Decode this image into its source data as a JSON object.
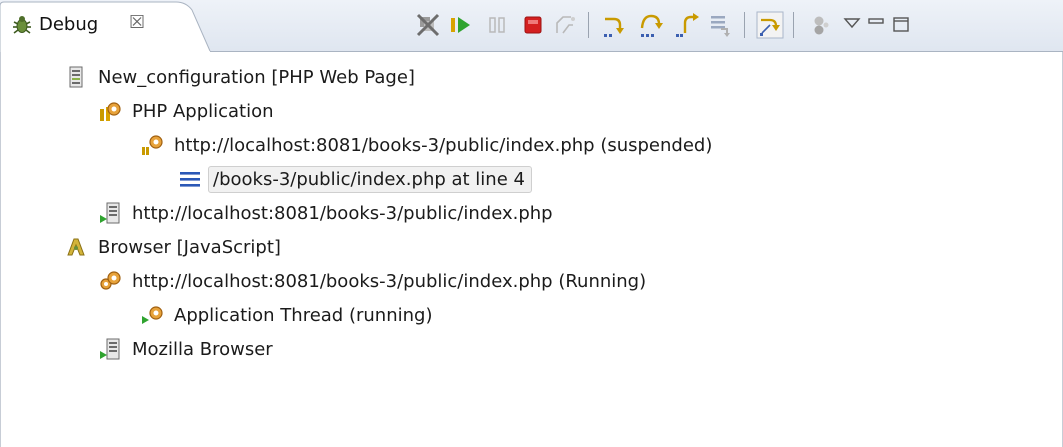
{
  "tab": {
    "label": "Debug",
    "close_glyph": "☒",
    "icon": "debug-bug-icon"
  },
  "toolbar": {
    "icons": [
      "remove-all-terminated-icon",
      "resume-icon",
      "suspend-icon",
      "terminate-icon",
      "disconnect-icon",
      "step-into-icon",
      "step-over-icon",
      "step-return-icon",
      "drop-to-frame-icon",
      "use-step-filters-icon",
      "collapse-icon",
      "view-menu-icon",
      "minimize-icon",
      "maximize-icon"
    ]
  },
  "colors": {
    "resume": "#2fa32f",
    "terminate": "#d42020",
    "step": "#c99a00",
    "selected_bg": "#f1f1f1",
    "tab_bg": "#e6ecf4"
  },
  "tree": {
    "items": [
      {
        "label": "New_configuration [PHP Web Page]",
        "icon": "launch-config-icon"
      },
      {
        "label": "PHP Application",
        "icon": "php-application-icon"
      },
      {
        "label": "http://localhost:8081/books-3/public/index.php (suspended)",
        "icon": "debug-target-suspended-icon"
      },
      {
        "label": "/books-3/public/index.php at line 4",
        "icon": "stack-frame-icon",
        "selected": true
      },
      {
        "label": "http://localhost:8081/books-3/public/index.php",
        "icon": "process-running-icon"
      },
      {
        "label": "Browser [JavaScript]",
        "icon": "javascript-launch-icon"
      },
      {
        "label": "http://localhost:8081/books-3/public/index.php (Running)",
        "icon": "debug-target-running-icon"
      },
      {
        "label": "Application Thread (running)",
        "icon": "thread-running-icon"
      },
      {
        "label": "Mozilla Browser",
        "icon": "process-running-icon"
      }
    ]
  }
}
